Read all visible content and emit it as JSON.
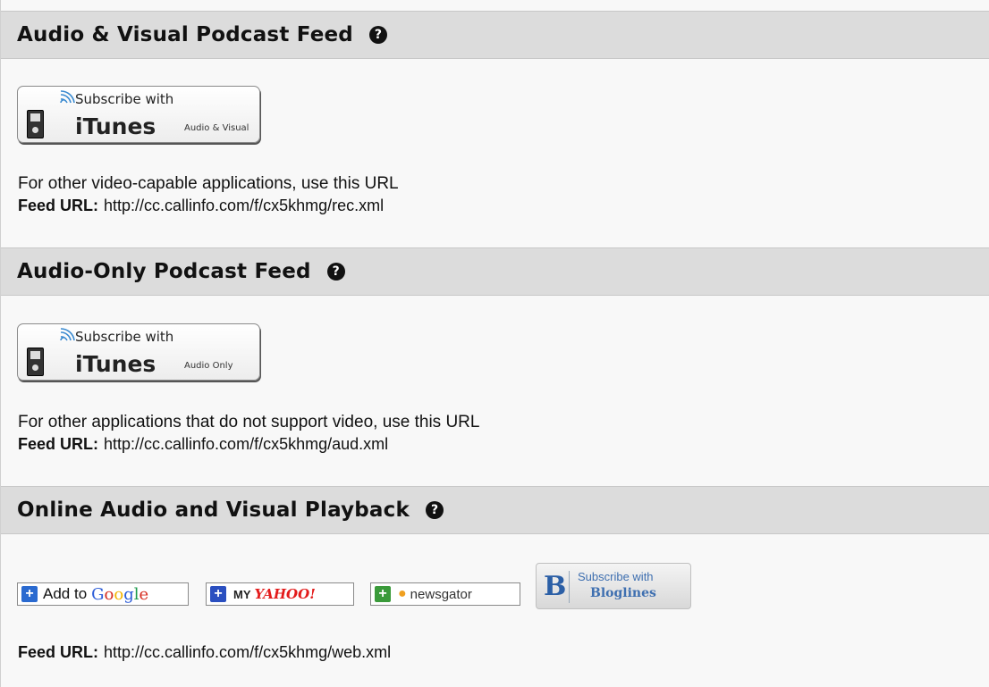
{
  "sections": [
    {
      "title": "Audio & Visual Podcast Feed",
      "help": "?",
      "itunes": {
        "subscribe": "Subscribe with",
        "brand": "iTunes",
        "type": "Audio & Visual"
      },
      "description": "For other video-capable applications, use this URL",
      "feed_label": "Feed URL:",
      "feed_url": "http://cc.callinfo.com/f/cx5khmg/rec.xml"
    },
    {
      "title": "Audio-Only Podcast Feed",
      "help": "?",
      "itunes": {
        "subscribe": "Subscribe with",
        "brand": "iTunes",
        "type": "Audio Only"
      },
      "description": "For other applications that do not support video, use this URL",
      "feed_label": "Feed URL:",
      "feed_url": "http://cc.callinfo.com/f/cx5khmg/aud.xml"
    },
    {
      "title": "Online Audio and Visual Playback",
      "help": "?",
      "readers": {
        "google": {
          "prefix": "Add to",
          "brand": "Google"
        },
        "yahoo": {
          "prefix": "MY",
          "brand": "YAHOO!"
        },
        "newsgator": {
          "brand": "newsgator"
        },
        "bloglines": {
          "line1": "Subscribe with",
          "line2": "Bloglines"
        }
      },
      "feed_label": "Feed URL:",
      "feed_url": "http://cc.callinfo.com/f/cx5khmg/web.xml"
    }
  ],
  "colors": {
    "header_bg": "#dcdcdc",
    "page_bg": "#f8f8f8",
    "google_plus": "#2a6ad0",
    "yahoo_plus": "#2a4fc0",
    "newsgator_plus": "#3a9a3a",
    "yahoo_red": "#e31b1b",
    "bloglines_blue": "#2b5fa6"
  },
  "icons": [
    "help-icon",
    "ipod-icon",
    "signal-icon",
    "plus-icon",
    "newsgator-icon",
    "bloglines-logo"
  ]
}
